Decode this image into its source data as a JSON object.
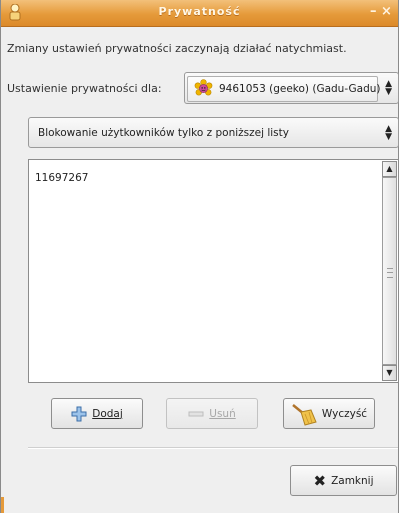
{
  "window": {
    "title": "Prywatność",
    "close_glyph": "– ×"
  },
  "info_text": "Zmiany ustawień prywatności zaczynają działać natychmiast.",
  "account": {
    "label": "Ustawienie prywatności dla:",
    "selected": "9461053 (geeko) (Gadu-Gadu)",
    "icon": "gadu-gadu-flower-icon"
  },
  "blocking": {
    "selected": "Blokowanie użytkowników tylko z poniższej listy"
  },
  "user_list": {
    "items": [
      "11697267"
    ]
  },
  "buttons": {
    "add_label": "Dodaj",
    "remove_label": "Usuń",
    "clear_label": "Wyczyść",
    "close_label": "Zamknij"
  },
  "colors": {
    "titlebar": "#e59a3a",
    "window_bg": "#efefef"
  }
}
